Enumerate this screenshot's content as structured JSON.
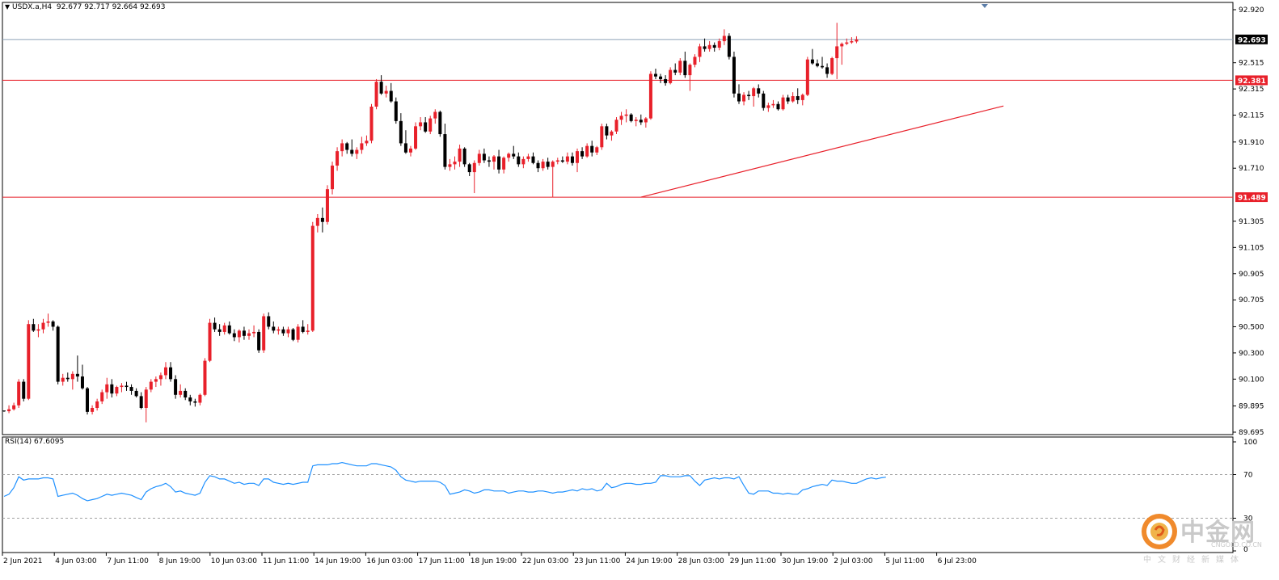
{
  "header": {
    "symbol": "USDX.a,H4",
    "ohlc": "92.677 92.717 92.664 92.693"
  },
  "rsi_panel": {
    "title": "RSI(14) 67.6095",
    "axis_labels": [
      "100",
      "70",
      "30",
      "0"
    ]
  },
  "price_axis": {
    "labels": [
      "92.920",
      "92.515",
      "92.315",
      "92.115",
      "91.910",
      "91.710",
      "91.305",
      "91.105",
      "90.905",
      "90.705",
      "90.500",
      "90.300",
      "90.100",
      "89.895",
      "89.695"
    ]
  },
  "price_tags": [
    {
      "id": "current",
      "label": "92.693",
      "value": 92.693,
      "color": "#000000",
      "text_color": "#ffffff"
    },
    {
      "id": "resistance",
      "label": "92.381",
      "value": 92.381,
      "color": "#e8202a",
      "text_color": "#ffffff"
    },
    {
      "id": "support",
      "label": "91.489",
      "value": 91.489,
      "color": "#e8202a",
      "text_color": "#ffffff"
    }
  ],
  "time_axis": {
    "labels": [
      "2 Jun 2021",
      "4 Jun 03:00",
      "7 Jun 11:00",
      "8 Jun 19:00",
      "10 Jun 03:00",
      "11 Jun 11:00",
      "14 Jun 19:00",
      "16 Jun 03:00",
      "17 Jun 11:00",
      "18 Jun 19:00",
      "22 Jun 03:00",
      "23 Jun 11:00",
      "24 Jun 19:00",
      "28 Jun 03:00",
      "29 Jun 11:00",
      "30 Jun 19:00",
      "2 Jul 03:00",
      "5 Jul 11:00",
      "6 Jul 23:00"
    ]
  },
  "colors": {
    "bull": "#e8202a",
    "bear": "#000000",
    "rsi_line": "#1e90ff",
    "level_line": "#e8202a",
    "bid_line": "#8da0b8",
    "frame": "#000000"
  },
  "watermark": {
    "title": "中金网",
    "domain": "CNGOLD.CO.CN",
    "slogan": "中文财经新媒体"
  },
  "chart_data": {
    "type": "candlestick",
    "symbol": "USDX.a",
    "timeframe": "H4",
    "ylim": [
      89.695,
      92.92
    ],
    "levels": [
      {
        "name": "resistance",
        "value": 92.381
      },
      {
        "name": "support",
        "value": 91.489
      },
      {
        "name": "bid",
        "value": 92.693
      }
    ],
    "trendline": {
      "from": {
        "bar": 130,
        "price": 91.489
      },
      "to": {
        "bar": 204,
        "price": 92.185
      }
    },
    "candles": [
      [
        89.86,
        89.86,
        89.85,
        89.855
      ],
      [
        89.855,
        89.9,
        89.84,
        89.87
      ],
      [
        89.87,
        89.92,
        89.86,
        89.9
      ],
      [
        89.9,
        90.1,
        89.88,
        90.08
      ],
      [
        90.08,
        90.1,
        89.93,
        89.95
      ],
      [
        89.95,
        90.55,
        89.94,
        90.52
      ],
      [
        90.52,
        90.56,
        90.46,
        90.47
      ],
      [
        90.47,
        90.52,
        90.42,
        90.48
      ],
      [
        90.48,
        90.56,
        90.45,
        90.53
      ],
      [
        90.53,
        90.6,
        90.5,
        90.54
      ],
      [
        90.54,
        90.55,
        90.47,
        90.5
      ],
      [
        90.5,
        90.51,
        90.06,
        90.08
      ],
      [
        90.08,
        90.14,
        90.05,
        90.11
      ],
      [
        90.11,
        90.15,
        90.08,
        90.1
      ],
      [
        90.1,
        90.16,
        90.02,
        90.14
      ],
      [
        90.14,
        90.28,
        90.08,
        90.12
      ],
      [
        90.12,
        90.21,
        90.02,
        90.03
      ],
      [
        90.03,
        90.04,
        89.83,
        89.85
      ],
      [
        89.85,
        89.9,
        89.83,
        89.88
      ],
      [
        89.88,
        89.95,
        89.86,
        89.93
      ],
      [
        89.93,
        90.02,
        89.91,
        90.0
      ],
      [
        90.0,
        90.11,
        89.95,
        90.06
      ],
      [
        90.06,
        90.1,
        89.96,
        89.99
      ],
      [
        89.99,
        90.05,
        89.97,
        90.04
      ],
      [
        90.04,
        90.07,
        90.0,
        90.05
      ],
      [
        90.05,
        90.08,
        90.01,
        90.04
      ],
      [
        90.04,
        90.06,
        89.98,
        90.01
      ],
      [
        90.01,
        90.03,
        89.96,
        89.97
      ],
      [
        89.97,
        90.0,
        89.87,
        89.88
      ],
      [
        89.88,
        90.04,
        89.77,
        90.02
      ],
      [
        90.02,
        90.1,
        90.0,
        90.08
      ],
      [
        90.08,
        90.12,
        90.04,
        90.1
      ],
      [
        90.1,
        90.15,
        90.05,
        90.13
      ],
      [
        90.13,
        90.23,
        90.1,
        90.19
      ],
      [
        90.19,
        90.23,
        90.08,
        90.1
      ],
      [
        90.1,
        90.13,
        89.95,
        89.98
      ],
      [
        89.98,
        90.06,
        89.96,
        90.01
      ],
      [
        90.01,
        90.03,
        89.94,
        89.96
      ],
      [
        89.96,
        89.98,
        89.9,
        89.93
      ],
      [
        89.93,
        89.95,
        89.89,
        89.92
      ],
      [
        89.92,
        89.99,
        89.9,
        89.98
      ],
      [
        89.98,
        90.26,
        89.97,
        90.24
      ],
      [
        90.24,
        90.56,
        90.23,
        90.53
      ],
      [
        90.53,
        90.57,
        90.46,
        90.48
      ],
      [
        90.48,
        90.52,
        90.43,
        90.46
      ],
      [
        90.46,
        90.53,
        90.44,
        90.51
      ],
      [
        90.51,
        90.54,
        90.44,
        90.45
      ],
      [
        90.45,
        90.48,
        90.39,
        90.42
      ],
      [
        90.42,
        90.48,
        90.38,
        90.47
      ],
      [
        90.47,
        90.5,
        90.4,
        90.43
      ],
      [
        90.43,
        90.48,
        90.4,
        90.45
      ],
      [
        90.45,
        90.51,
        90.42,
        90.46
      ],
      [
        90.46,
        90.48,
        90.3,
        90.32
      ],
      [
        90.32,
        90.6,
        90.3,
        90.58
      ],
      [
        90.58,
        90.61,
        90.48,
        90.5
      ],
      [
        90.5,
        90.54,
        90.45,
        90.47
      ],
      [
        90.47,
        90.5,
        90.44,
        90.48
      ],
      [
        90.48,
        90.5,
        90.43,
        90.45
      ],
      [
        90.45,
        90.5,
        90.42,
        90.48
      ],
      [
        90.48,
        90.49,
        90.39,
        90.4
      ],
      [
        90.4,
        90.52,
        90.38,
        90.5
      ],
      [
        90.5,
        90.55,
        90.45,
        90.46
      ],
      [
        90.46,
        90.52,
        90.44,
        90.47
      ],
      [
        90.47,
        91.3,
        90.46,
        91.27
      ],
      [
        91.27,
        91.36,
        91.22,
        91.33
      ],
      [
        91.33,
        91.41,
        91.22,
        91.3
      ],
      [
        91.3,
        91.58,
        91.28,
        91.55
      ],
      [
        91.55,
        91.76,
        91.51,
        91.73
      ],
      [
        91.73,
        91.87,
        91.69,
        91.84
      ],
      [
        91.84,
        91.93,
        91.8,
        91.9
      ],
      [
        91.9,
        91.91,
        91.82,
        91.85
      ],
      [
        91.85,
        91.93,
        91.8,
        91.82
      ],
      [
        91.82,
        91.87,
        91.78,
        91.85
      ],
      [
        91.85,
        91.95,
        91.82,
        91.9
      ],
      [
        91.9,
        91.96,
        91.88,
        91.92
      ],
      [
        91.92,
        92.2,
        91.9,
        92.18
      ],
      [
        92.18,
        92.39,
        92.16,
        92.37
      ],
      [
        92.37,
        92.42,
        92.27,
        92.28
      ],
      [
        92.28,
        92.34,
        92.25,
        92.3
      ],
      [
        92.3,
        92.36,
        92.21,
        92.22
      ],
      [
        92.22,
        92.25,
        92.05,
        92.07
      ],
      [
        92.07,
        92.13,
        91.88,
        91.9
      ],
      [
        91.9,
        92.0,
        91.82,
        91.83
      ],
      [
        91.83,
        91.88,
        91.8,
        91.86
      ],
      [
        91.86,
        92.06,
        91.85,
        92.03
      ],
      [
        92.03,
        92.1,
        92.0,
        92.06
      ],
      [
        92.06,
        92.1,
        91.98,
        91.99
      ],
      [
        91.99,
        92.11,
        91.97,
        92.09
      ],
      [
        92.09,
        92.16,
        92.05,
        92.14
      ],
      [
        92.14,
        92.15,
        91.95,
        91.97
      ],
      [
        91.97,
        92.05,
        91.7,
        91.72
      ],
      [
        91.72,
        91.78,
        91.69,
        91.74
      ],
      [
        91.74,
        91.8,
        91.7,
        91.76
      ],
      [
        91.76,
        91.89,
        91.72,
        91.86
      ],
      [
        91.86,
        91.87,
        91.72,
        91.74
      ],
      [
        91.74,
        91.75,
        91.65,
        91.68
      ],
      [
        91.68,
        91.77,
        91.52,
        91.75
      ],
      [
        91.75,
        91.85,
        91.73,
        91.82
      ],
      [
        91.82,
        91.86,
        91.75,
        91.77
      ],
      [
        91.77,
        91.8,
        91.72,
        91.76
      ],
      [
        91.76,
        91.81,
        91.7,
        91.8
      ],
      [
        91.8,
        91.85,
        91.67,
        91.7
      ],
      [
        91.7,
        91.8,
        91.67,
        91.79
      ],
      [
        91.79,
        91.83,
        91.76,
        91.82
      ],
      [
        91.82,
        91.88,
        91.78,
        91.8
      ],
      [
        91.8,
        91.83,
        91.72,
        91.74
      ],
      [
        91.74,
        91.8,
        91.71,
        91.78
      ],
      [
        91.78,
        91.82,
        91.76,
        91.8
      ],
      [
        91.8,
        91.83,
        91.74,
        91.75
      ],
      [
        91.75,
        91.77,
        91.68,
        91.71
      ],
      [
        91.71,
        91.78,
        91.69,
        91.76
      ],
      [
        91.76,
        91.79,
        91.7,
        91.72
      ],
      [
        91.72,
        91.77,
        91.49,
        91.76
      ],
      [
        91.76,
        91.79,
        91.74,
        91.77
      ],
      [
        91.77,
        91.8,
        91.75,
        91.76
      ],
      [
        91.76,
        91.83,
        91.74,
        91.8
      ],
      [
        91.8,
        91.83,
        91.73,
        91.75
      ],
      [
        91.75,
        91.86,
        91.68,
        91.84
      ],
      [
        91.84,
        91.87,
        91.78,
        91.8
      ],
      [
        91.8,
        91.9,
        91.79,
        91.88
      ],
      [
        91.88,
        91.92,
        91.8,
        91.83
      ],
      [
        91.83,
        91.88,
        91.81,
        91.87
      ],
      [
        91.87,
        92.05,
        91.85,
        92.03
      ],
      [
        92.03,
        92.05,
        91.93,
        91.96
      ],
      [
        91.96,
        92.0,
        91.92,
        91.99
      ],
      [
        91.99,
        92.1,
        91.97,
        92.08
      ],
      [
        92.08,
        92.14,
        92.04,
        92.11
      ],
      [
        92.11,
        92.16,
        92.06,
        92.12
      ],
      [
        92.12,
        92.13,
        92.06,
        92.07
      ],
      [
        92.07,
        92.1,
        92.03,
        92.08
      ],
      [
        92.08,
        92.12,
        92.04,
        92.06
      ],
      [
        92.06,
        92.1,
        92.02,
        92.09
      ],
      [
        92.09,
        92.45,
        92.08,
        92.43
      ],
      [
        92.43,
        92.47,
        92.39,
        92.41
      ],
      [
        92.41,
        92.43,
        92.36,
        92.39
      ],
      [
        92.39,
        92.42,
        92.34,
        92.36
      ],
      [
        92.36,
        92.48,
        92.35,
        92.46
      ],
      [
        92.46,
        92.51,
        92.42,
        92.44
      ],
      [
        92.44,
        92.55,
        92.42,
        92.53
      ],
      [
        92.53,
        92.6,
        92.4,
        92.42
      ],
      [
        92.42,
        92.51,
        92.3,
        92.5
      ],
      [
        92.5,
        92.58,
        92.48,
        92.56
      ],
      [
        92.56,
        92.66,
        92.52,
        92.64
      ],
      [
        92.64,
        92.7,
        92.6,
        92.62
      ],
      [
        92.62,
        92.68,
        92.6,
        92.65
      ],
      [
        92.65,
        92.67,
        92.6,
        92.63
      ],
      [
        92.63,
        92.7,
        92.61,
        92.68
      ],
      [
        92.68,
        92.77,
        92.65,
        92.72
      ],
      [
        92.72,
        92.74,
        92.54,
        92.56
      ],
      [
        92.56,
        92.6,
        92.25,
        92.28
      ],
      [
        92.28,
        92.35,
        92.2,
        92.22
      ],
      [
        92.22,
        92.29,
        92.19,
        92.27
      ],
      [
        92.27,
        92.3,
        92.23,
        92.26
      ],
      [
        92.26,
        92.33,
        92.18,
        92.32
      ],
      [
        92.32,
        92.35,
        92.25,
        92.28
      ],
      [
        92.28,
        92.3,
        92.15,
        92.17
      ],
      [
        92.17,
        92.21,
        92.14,
        92.19
      ],
      [
        92.19,
        92.23,
        92.17,
        92.2
      ],
      [
        92.2,
        92.22,
        92.15,
        92.16
      ],
      [
        92.16,
        92.27,
        92.15,
        92.25
      ],
      [
        92.25,
        92.27,
        92.2,
        92.22
      ],
      [
        92.22,
        92.29,
        92.21,
        92.26
      ],
      [
        92.26,
        92.32,
        92.2,
        92.23
      ],
      [
        92.23,
        92.28,
        92.19,
        92.27
      ],
      [
        92.27,
        92.56,
        92.26,
        92.54
      ],
      [
        92.54,
        92.62,
        92.5,
        92.51
      ],
      [
        92.51,
        92.54,
        92.48,
        92.49
      ],
      [
        92.49,
        92.56,
        92.47,
        92.48
      ],
      [
        92.48,
        92.51,
        92.4,
        92.43
      ],
      [
        92.43,
        92.56,
        92.42,
        92.55
      ],
      [
        92.55,
        92.82,
        92.39,
        92.64
      ],
      [
        92.64,
        92.67,
        92.5,
        92.66
      ],
      [
        92.66,
        92.7,
        92.65,
        92.67
      ],
      [
        92.67,
        92.71,
        92.66,
        92.68
      ],
      [
        92.677,
        92.717,
        92.664,
        92.693
      ]
    ],
    "rsi": {
      "name": "RSI(14)",
      "last": 67.6095,
      "ylim": [
        0,
        100
      ],
      "levels": [
        30,
        70
      ],
      "values": [
        50,
        52,
        58,
        68,
        65,
        66,
        66,
        66,
        67,
        67,
        66,
        50,
        51,
        52,
        53,
        51,
        48,
        46,
        47,
        48,
        50,
        52,
        51,
        52,
        53,
        52,
        51,
        49,
        47,
        54,
        57,
        59,
        60,
        62,
        59,
        54,
        55,
        53,
        52,
        51,
        53,
        63,
        69,
        68,
        66,
        66,
        64,
        62,
        63,
        61,
        62,
        62,
        60,
        66,
        66,
        63,
        62,
        61,
        62,
        61,
        62,
        63,
        63,
        78,
        79,
        79,
        79,
        80,
        80,
        81,
        80,
        79,
        78,
        78,
        78,
        80,
        80,
        79,
        78,
        77,
        74,
        68,
        65,
        64,
        63,
        64,
        64,
        64,
        64,
        63,
        60,
        52,
        53,
        54,
        56,
        55,
        53,
        54,
        56,
        56,
        55,
        55,
        55,
        53,
        54,
        55,
        55,
        54,
        54,
        55,
        55,
        54,
        53,
        54,
        54,
        55,
        56,
        55,
        57,
        56,
        57,
        55,
        56,
        62,
        58,
        59,
        61,
        62,
        62,
        61,
        61,
        62,
        62,
        63,
        69,
        69,
        68,
        68,
        68,
        69,
        69,
        64,
        60,
        65,
        66,
        67,
        66,
        67,
        67,
        66,
        68,
        60,
        53,
        52,
        55,
        55,
        55,
        53,
        53,
        52,
        53,
        52,
        52,
        56,
        57,
        59,
        60,
        61,
        60,
        65,
        64,
        64,
        63,
        62,
        62,
        64,
        66,
        67,
        66,
        67,
        67.6
      ]
    }
  }
}
